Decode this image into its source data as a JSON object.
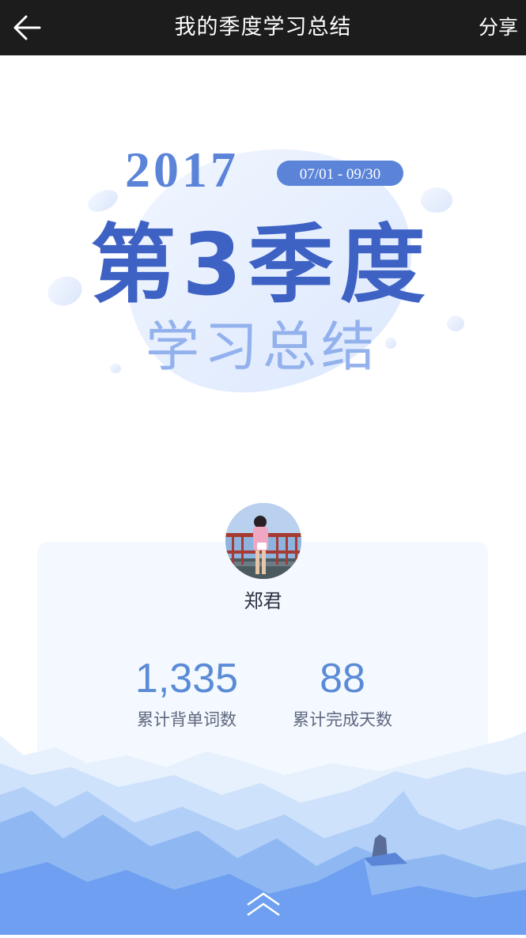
{
  "header": {
    "title": "我的季度学习总结",
    "share_label": "分享",
    "back_icon": "arrow-left-icon"
  },
  "hero": {
    "year": "2017",
    "date_range": "07/01 - 09/30",
    "headline": "第3季度",
    "subheadline": "学习总结"
  },
  "profile": {
    "name": "郑君"
  },
  "stats": [
    {
      "value": "1,335",
      "label": "累计背单词数"
    },
    {
      "value": "88",
      "label": "累计完成天数"
    }
  ],
  "footer": {
    "scroll_icon": "chevron-double-up-icon"
  },
  "colors": {
    "header_bg": "#1c1c1c",
    "accent": "#5b8bd6",
    "title_blue": "#3d62c4",
    "card_bg": "#f3f9fe"
  }
}
